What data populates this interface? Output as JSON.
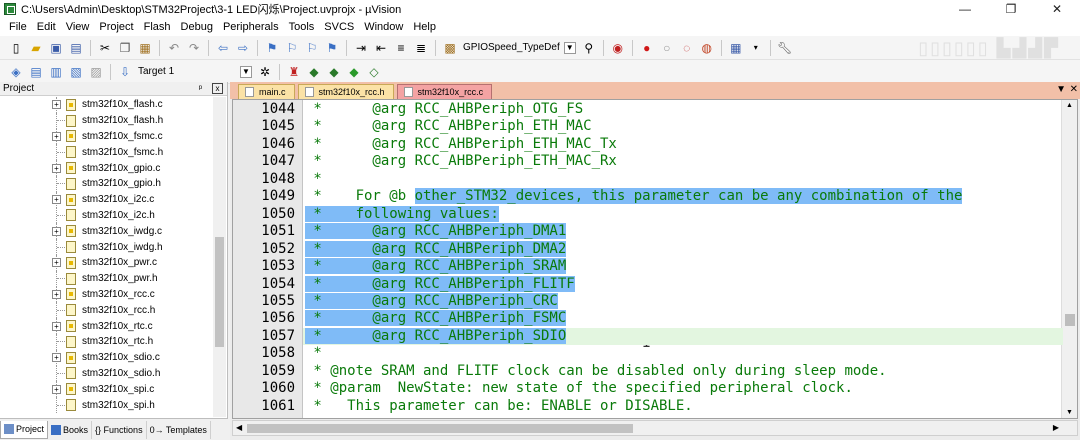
{
  "window": {
    "title": "C:\\Users\\Admin\\Desktop\\STM32Project\\3-1 LED闪烁\\Project.uvprojx - µVision",
    "minimize": "—",
    "restore": "❐",
    "close": "✕"
  },
  "menu": [
    "File",
    "Edit",
    "View",
    "Project",
    "Flash",
    "Debug",
    "Peripherals",
    "Tools",
    "SVCS",
    "Window",
    "Help"
  ],
  "toolbar": {
    "function_combo": "GPIOSpeed_TypeDef",
    "target_combo": "Target 1"
  },
  "project_panel": {
    "title": "Project",
    "pin": "ᵖ",
    "close": "x",
    "files": [
      {
        "name": "stm32f10x_flash.c",
        "type": "c"
      },
      {
        "name": "stm32f10x_flash.h",
        "type": "h"
      },
      {
        "name": "stm32f10x_fsmc.c",
        "type": "c"
      },
      {
        "name": "stm32f10x_fsmc.h",
        "type": "h"
      },
      {
        "name": "stm32f10x_gpio.c",
        "type": "c"
      },
      {
        "name": "stm32f10x_gpio.h",
        "type": "h"
      },
      {
        "name": "stm32f10x_i2c.c",
        "type": "c"
      },
      {
        "name": "stm32f10x_i2c.h",
        "type": "h"
      },
      {
        "name": "stm32f10x_iwdg.c",
        "type": "c"
      },
      {
        "name": "stm32f10x_iwdg.h",
        "type": "h"
      },
      {
        "name": "stm32f10x_pwr.c",
        "type": "c"
      },
      {
        "name": "stm32f10x_pwr.h",
        "type": "h"
      },
      {
        "name": "stm32f10x_rcc.c",
        "type": "c"
      },
      {
        "name": "stm32f10x_rcc.h",
        "type": "h"
      },
      {
        "name": "stm32f10x_rtc.c",
        "type": "c"
      },
      {
        "name": "stm32f10x_rtc.h",
        "type": "h"
      },
      {
        "name": "stm32f10x_sdio.c",
        "type": "c"
      },
      {
        "name": "stm32f10x_sdio.h",
        "type": "h"
      },
      {
        "name": "stm32f10x_spi.c",
        "type": "c"
      },
      {
        "name": "stm32f10x_spi.h",
        "type": "h"
      }
    ],
    "tabs": [
      "Project",
      "Books",
      "{} Functions",
      "0→ Templates"
    ]
  },
  "editor": {
    "tabs": [
      {
        "label": "main.c",
        "active": false
      },
      {
        "label": "stm32f10x_rcc.h",
        "active": false
      },
      {
        "label": "stm32f10x_rcc.c",
        "active": true
      }
    ],
    "lines": [
      {
        "num": "1044",
        "code": " *      @arg RCC_AHBPeriph_OTG_FS"
      },
      {
        "num": "1045",
        "code": " *      @arg RCC_AHBPeriph_ETH_MAC"
      },
      {
        "num": "1046",
        "code": " *      @arg RCC_AHBPeriph_ETH_MAC_Tx"
      },
      {
        "num": "1047",
        "code": " *      @arg RCC_AHBPeriph_ETH_MAC_Rx"
      },
      {
        "num": "1048",
        "code": " *"
      },
      {
        "num": "1049",
        "code_pre": " *    For @b ",
        "code_sel": "other_STM32_devices, this parameter can be any combination of the"
      },
      {
        "num": "1050",
        "code_pre": "",
        "code_sel": " *    following values:"
      },
      {
        "num": "1051",
        "code_pre": "",
        "code_sel": " *      @arg RCC_AHBPeriph_DMA1"
      },
      {
        "num": "1052",
        "code_pre": "",
        "code_sel": " *      @arg RCC_AHBPeriph_DMA2"
      },
      {
        "num": "1053",
        "code_pre": "",
        "code_sel": " *      @arg RCC_AHBPeriph_SRAM"
      },
      {
        "num": "1054",
        "code_pre": "",
        "code_sel": " *      @arg RCC_AHBPeriph_FLITF"
      },
      {
        "num": "1055",
        "code_pre": "",
        "code_sel": " *      @arg RCC_AHBPeriph_CRC"
      },
      {
        "num": "1056",
        "code_pre": "",
        "code_sel": " *      @arg RCC_AHBPeriph_FSMC"
      },
      {
        "num": "1057",
        "code_pre": "",
        "code_sel": " *      @arg RCC_AHBPeriph_SDIO",
        "current": true
      },
      {
        "num": "1058",
        "code": " *"
      },
      {
        "num": "1059",
        "code": " * @note SRAM and FLITF clock can be disabled only during sleep mode."
      },
      {
        "num": "1060",
        "code": " * @param  NewState: new state of the specified peripheral clock."
      },
      {
        "num": "1061",
        "code": " *   This parameter can be: ENABLE or DISABLE."
      }
    ],
    "cursor": "I"
  },
  "colors": {
    "comment": "#0a7a0a",
    "selection": "#7fbbf7",
    "current_line": "#e3f6e0",
    "active_tab": "#f4a3a3",
    "inactive_tab": "#fbe2a6",
    "tabbar": "#f2c0a8"
  }
}
